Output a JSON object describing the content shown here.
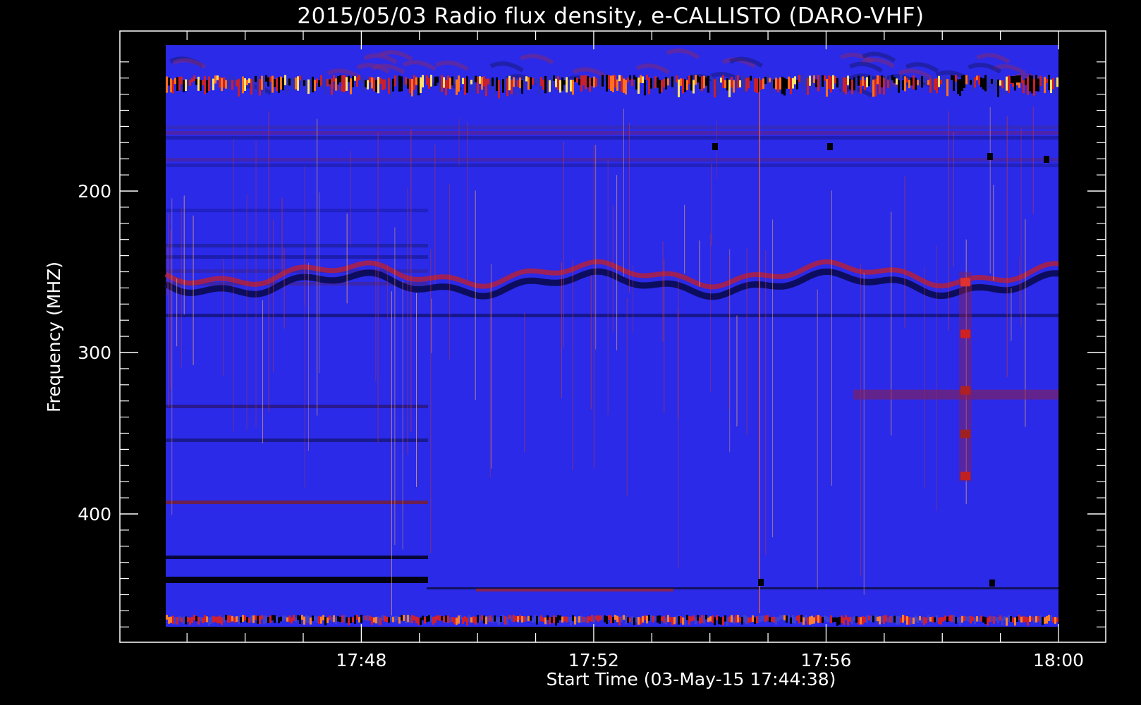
{
  "chart_data": {
    "type": "heatmap",
    "title": "2015/05/03  Radio flux density, e-CALLISTO (DARO-VHF)",
    "xlabel": "Start Time (03-May-15 17:44:38)",
    "ylabel": "Frequency (MHZ)",
    "x_range": [
      "17:44:38",
      "18:00:00"
    ],
    "y_range_mhz": [
      110,
      470
    ],
    "y_ticks": [
      200,
      300,
      400
    ],
    "x_ticks": [
      "17:48",
      "17:52",
      "17:56",
      "18:00"
    ],
    "colormap": [
      "#000000",
      "#2525ff",
      "#c01828",
      "#ffe070"
    ],
    "background_color": "#2a2ae8",
    "features": [
      {
        "type": "broadband_interference",
        "freq_mhz": 132
      },
      {
        "type": "wavy_band",
        "freq_mhz": 255
      },
      {
        "type": "band_edge",
        "freq_mhz": 465
      }
    ]
  }
}
